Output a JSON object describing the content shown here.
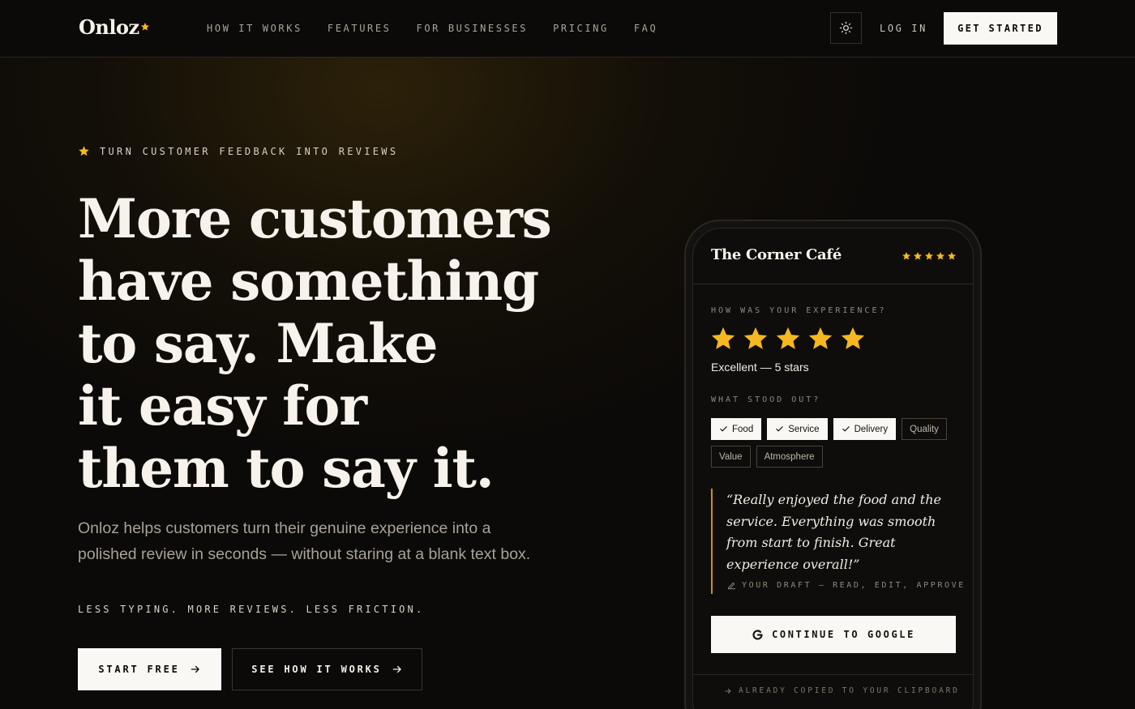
{
  "colors": {
    "accent": "#f5b820",
    "background": "#0c0a08",
    "text": "#f3efe7",
    "muted": "#a7a198"
  },
  "nav": {
    "logo": "Onloz",
    "links": [
      {
        "label": "HOW IT WORKS"
      },
      {
        "label": "FEATURES"
      },
      {
        "label": "FOR BUSINESSES"
      },
      {
        "label": "PRICING"
      },
      {
        "label": "FAQ"
      }
    ],
    "theme_icon": "sun-icon",
    "login": "LOG IN",
    "cta": "GET STARTED"
  },
  "hero": {
    "eyebrow": "TURN CUSTOMER FEEDBACK INTO REVIEWS",
    "headline_lines": [
      "More customers",
      "have something",
      "to say. Make",
      "it easy for",
      "them to say it."
    ],
    "subtext": "Onloz helps customers turn their genuine experience into a polished review in seconds — without staring at a blank text box.",
    "tagline": "LESS TYPING. MORE REVIEWS. LESS FRICTION.",
    "primary_button": "START FREE",
    "secondary_button": "SEE HOW IT WORKS"
  },
  "phone": {
    "business_name": "The Corner Café",
    "header_rating": 5,
    "experience_label": "HOW WAS YOUR EXPERIENCE?",
    "rating": 5,
    "rating_text": "Excellent — 5 stars",
    "stood_out_label": "WHAT STOOD OUT?",
    "chips": [
      {
        "label": "Food",
        "selected": true
      },
      {
        "label": "Service",
        "selected": true
      },
      {
        "label": "Delivery",
        "selected": true
      },
      {
        "label": "Quality",
        "selected": false
      },
      {
        "label": "Value",
        "selected": false
      },
      {
        "label": "Atmosphere",
        "selected": false
      }
    ],
    "quote": "“Really enjoyed the food and the service. Everything was smooth from start to finish. Great experience overall!”",
    "draft_note": "YOUR DRAFT — READ, EDIT, APPROVE",
    "google_button": "CONTINUE TO GOOGLE",
    "footer_note": "ALREADY COPIED TO YOUR CLIPBOARD"
  }
}
